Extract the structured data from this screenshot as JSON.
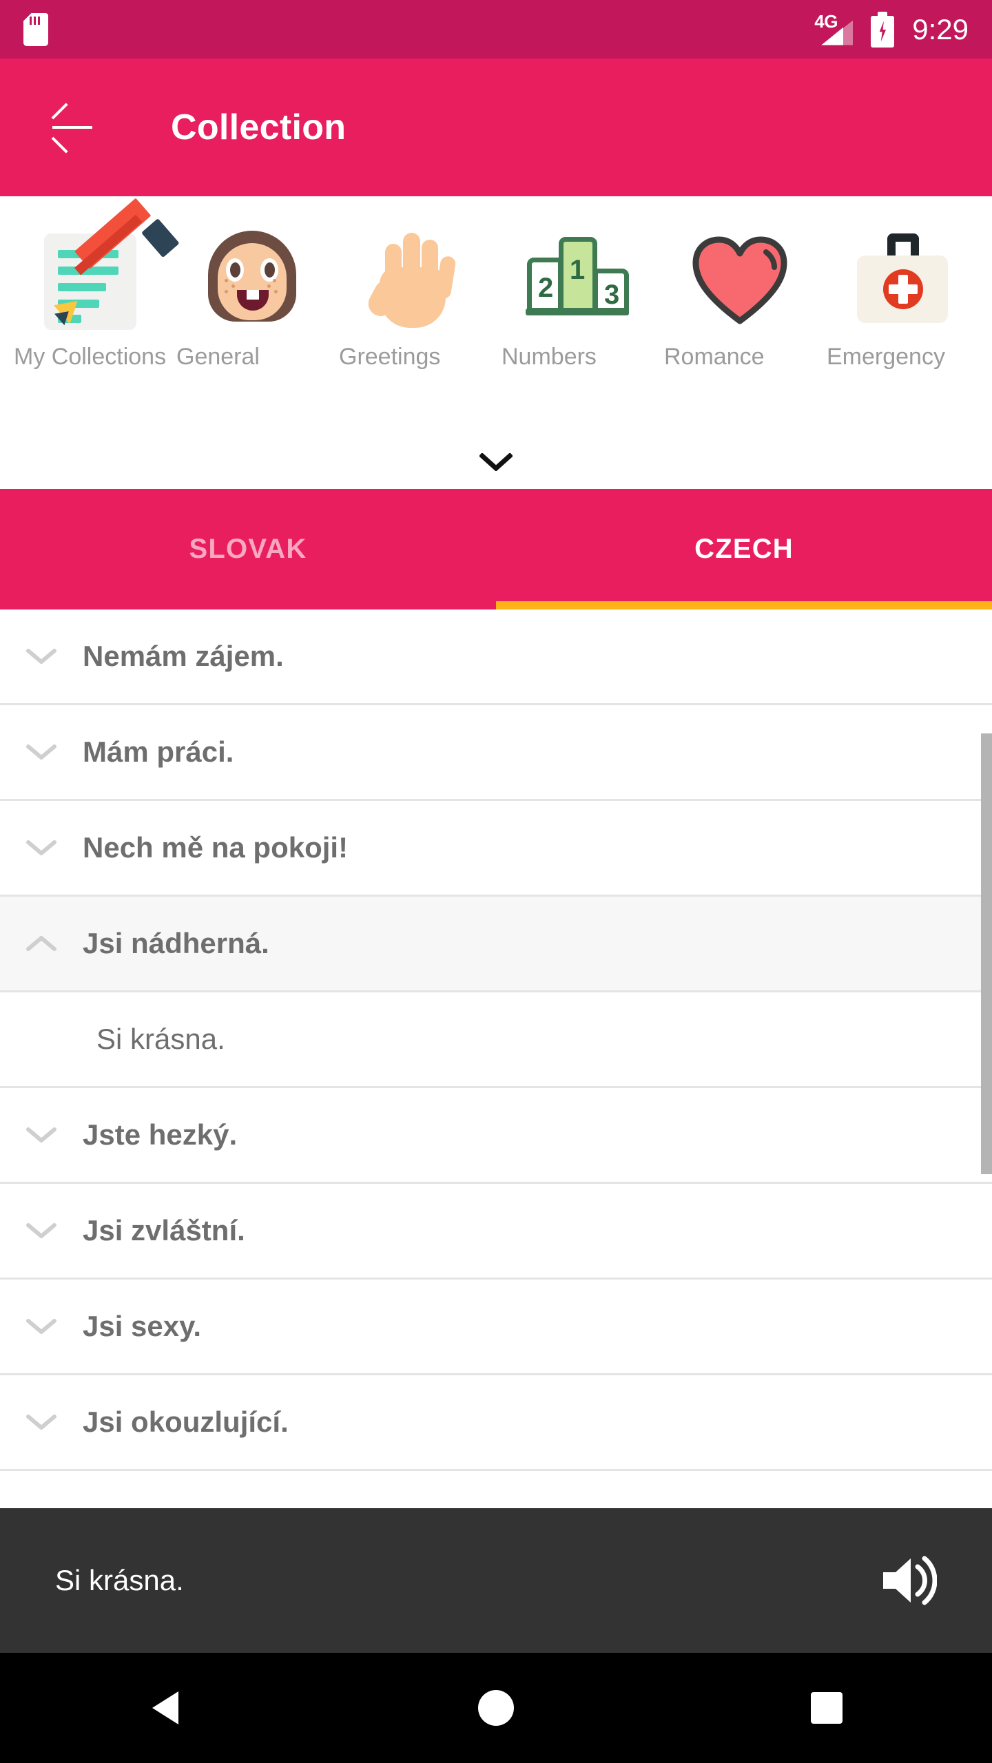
{
  "status_bar": {
    "sd_card_icon": "sd-card-icon",
    "network_label": "4G",
    "signal_icon": "signal-bars-icon",
    "battery_icon": "battery-charging-icon",
    "time": "9:29",
    "background_color": "#C2175B"
  },
  "toolbar": {
    "back_icon": "back-arrow-icon",
    "title": "Collection",
    "background_color": "#E91E5F"
  },
  "categories": {
    "expand_icon": "chevron-down-icon",
    "items": [
      {
        "label": "My Collections",
        "icon": "memo-pencil-icon"
      },
      {
        "label": "General",
        "icon": "girl-face-icon"
      },
      {
        "label": "Greetings",
        "icon": "raised-hand-icon"
      },
      {
        "label": "Numbers",
        "icon": "podium-123-icon"
      },
      {
        "label": "Romance",
        "icon": "heart-icon"
      },
      {
        "label": "Emergency",
        "icon": "first-aid-kit-icon"
      }
    ]
  },
  "tabs": {
    "items": [
      {
        "label": "SLOVAK",
        "active": false
      },
      {
        "label": "CZECH",
        "active": true
      }
    ],
    "indicator_color": "#FFB21A"
  },
  "phrase_list": {
    "rows": [
      {
        "text": "Nemám zájem.",
        "expanded": false,
        "chevron": "chevron-down-icon"
      },
      {
        "text": "Mám práci.",
        "expanded": false,
        "chevron": "chevron-down-icon"
      },
      {
        "text": "Nech mě na pokoji!",
        "expanded": false,
        "chevron": "chevron-down-icon"
      },
      {
        "text": "Jsi nádherná.",
        "expanded": true,
        "chevron": "chevron-up-icon",
        "translation": "Si krásna."
      },
      {
        "text": "Jste hezký.",
        "expanded": false,
        "chevron": "chevron-down-icon"
      },
      {
        "text": "Jsi zvláštní.",
        "expanded": false,
        "chevron": "chevron-down-icon"
      },
      {
        "text": "Jsi sexy.",
        "expanded": false,
        "chevron": "chevron-down-icon"
      },
      {
        "text": "Jsi okouzlující.",
        "expanded": false,
        "chevron": "chevron-down-icon"
      }
    ],
    "scrollbar": "vertical-scrollbar"
  },
  "player": {
    "text": "Si krásna.",
    "speaker_icon": "speaker-volume-icon",
    "background_color": "#333333"
  },
  "nav_bar": {
    "back_icon": "nav-back-triangle-icon",
    "home_icon": "nav-home-circle-icon",
    "recents_icon": "nav-recents-square-icon"
  }
}
